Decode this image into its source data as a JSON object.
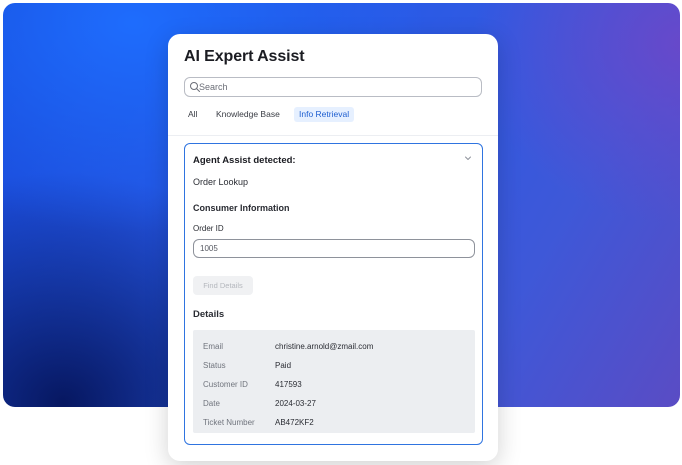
{
  "app": {
    "title": "AI Expert Assist"
  },
  "search": {
    "placeholder": "Search",
    "value": ""
  },
  "tabs": [
    {
      "label": "All",
      "active": false
    },
    {
      "label": "Knowledge Base",
      "active": false
    },
    {
      "label": "Info Retrieval",
      "active": true
    }
  ],
  "card": {
    "title": "Agent Assist detected:",
    "workflow": "Order Lookup",
    "section_title": "Consumer Information",
    "order_id": {
      "label": "Order ID",
      "value": "1005"
    },
    "find_button_label": "Find Details",
    "details_title": "Details",
    "details": [
      {
        "key": "Email",
        "value": "christine.arnold@zmail.com"
      },
      {
        "key": "Status",
        "value": "Paid"
      },
      {
        "key": "Customer ID",
        "value": "417593"
      },
      {
        "key": "Date",
        "value": "2024-03-27"
      },
      {
        "key": "Ticket Number",
        "value": "AB472KF2"
      }
    ]
  },
  "icons": {
    "search": "search-icon",
    "chevron": "chevron-down-icon"
  },
  "colors": {
    "accent": "#2f74e0",
    "active_tab_bg": "#e6f0ff",
    "active_tab_text": "#1f5fd0"
  }
}
